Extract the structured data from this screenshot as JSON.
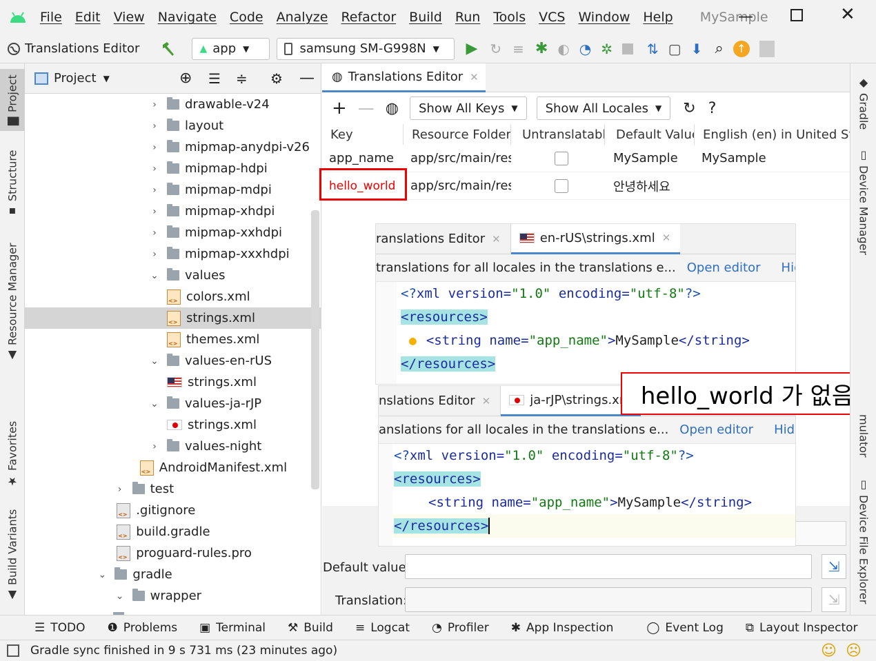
{
  "menubar": {
    "items": [
      "File",
      "Edit",
      "View",
      "Navigate",
      "Code",
      "Analyze",
      "Refactor",
      "Build",
      "Run",
      "Tools",
      "VCS",
      "Window",
      "Help"
    ],
    "project_name": "MySample",
    "window_controls": [
      "minimize-icon",
      "maximize-icon",
      "close-icon"
    ]
  },
  "toolbar": {
    "breadcrumb": "Translations Editor",
    "module": "app",
    "device": "samsung SM-G998N"
  },
  "left_tool_tabs": [
    "Project",
    "Structure",
    "Resource Manager",
    "Favorites",
    "Build Variants"
  ],
  "right_tool_tabs": [
    "Gradle",
    "Device Manager",
    "mulator",
    "Device File Explorer"
  ],
  "project_panel": {
    "title": "Project",
    "tree": [
      {
        "label": "drawable-v24",
        "type": "folder",
        "arrow": "›",
        "indent": 1
      },
      {
        "label": "layout",
        "type": "folder",
        "arrow": "›",
        "indent": 1
      },
      {
        "label": "mipmap-anydpi-v26",
        "type": "folder",
        "arrow": "›",
        "indent": 1
      },
      {
        "label": "mipmap-hdpi",
        "type": "folder",
        "arrow": "›",
        "indent": 1
      },
      {
        "label": "mipmap-mdpi",
        "type": "folder",
        "arrow": "›",
        "indent": 1
      },
      {
        "label": "mipmap-xhdpi",
        "type": "folder",
        "arrow": "›",
        "indent": 1
      },
      {
        "label": "mipmap-xxhdpi",
        "type": "folder",
        "arrow": "›",
        "indent": 1
      },
      {
        "label": "mipmap-xxxhdpi",
        "type": "folder",
        "arrow": "›",
        "indent": 1
      },
      {
        "label": "values",
        "type": "folder",
        "arrow": "⌄",
        "indent": 1
      },
      {
        "label": "colors.xml",
        "type": "xml",
        "arrow": "",
        "indent": 2
      },
      {
        "label": "strings.xml",
        "type": "xml",
        "arrow": "",
        "indent": 2,
        "selected": true
      },
      {
        "label": "themes.xml",
        "type": "xml",
        "arrow": "",
        "indent": 2
      },
      {
        "label": "values-en-rUS",
        "type": "folder",
        "arrow": "⌄",
        "indent": 1
      },
      {
        "label": "strings.xml",
        "type": "flag-us",
        "arrow": "",
        "indent": 2
      },
      {
        "label": "values-ja-rJP",
        "type": "folder",
        "arrow": "⌄",
        "indent": 1
      },
      {
        "label": "strings.xml",
        "type": "flag-jp",
        "arrow": "",
        "indent": 2
      },
      {
        "label": "values-night",
        "type": "folder",
        "arrow": "›",
        "indent": 1
      },
      {
        "label": "AndroidManifest.xml",
        "type": "manifest",
        "arrow": "",
        "indent": 0.6
      },
      {
        "label": "test",
        "type": "folder",
        "arrow": "›",
        "indent": -0.8
      },
      {
        "label": ".gitignore",
        "type": "file",
        "arrow": "",
        "indent": -0.6
      },
      {
        "label": "build.gradle",
        "type": "gradle",
        "arrow": "",
        "indent": -0.6
      },
      {
        "label": "proguard-rules.pro",
        "type": "file",
        "arrow": "",
        "indent": -0.6
      },
      {
        "label": "gradle",
        "type": "folder",
        "arrow": "⌄",
        "indent": -1.7
      },
      {
        "label": "wrapper",
        "type": "folder",
        "arrow": "⌄",
        "indent": -0.8
      }
    ]
  },
  "editor": {
    "tab_label": "Translations Editor",
    "show_keys": "Show All Keys",
    "show_locales": "Show All Locales",
    "help": "?",
    "columns": [
      "Key",
      "Resource Folder",
      "Untranslatable",
      "Default Value",
      "English (en) in United Sta"
    ],
    "rows": [
      {
        "key": "app_name",
        "folder": "app/src/main/res",
        "default": "MySample",
        "english": "MySample"
      },
      {
        "key": "hello_world",
        "folder": "app/src/main/res",
        "default": "안녕하세요",
        "english": ""
      }
    ],
    "default_value_label": "Default value:",
    "translation_label": "Translation:"
  },
  "overlay_us": {
    "tab_prev": "ranslations Editor",
    "tab_active": "en-rUS\\strings.xml",
    "notice": "translations for all locales in the translations e...",
    "open_editor": "Open editor",
    "hide": "Hide nc",
    "code": [
      "<?xml version=\"1.0\" encoding=\"utf-8\"?>",
      "<resources>",
      "    <string name=\"app_name\">MySample</string>",
      "</resources>"
    ]
  },
  "overlay_jp": {
    "tab_prev": "nslations Editor",
    "tab_active": "ja-rJP\\strings.xm",
    "notice": "anslations for all locales in the translations e...",
    "open_editor": "Open editor",
    "hide": "Hide not",
    "code": [
      "<?xml version=\"1.0\" encoding=\"utf-8\"?>",
      "<resources>",
      "    <string name=\"app_name\">MySample</string>",
      "</resources>"
    ]
  },
  "callout": "hello_world 가 없음",
  "bottom_tabs": [
    "TODO",
    "Problems",
    "Terminal",
    "Build",
    "Logcat",
    "Profiler",
    "App Inspection",
    "Event Log",
    "Layout Inspector"
  ],
  "status": "Gradle sync finished in 9 s 731 ms (23 minutes ago)",
  "colors": {
    "highlight_red": "#e00000",
    "link": "#2f6fc0",
    "tag_bg": "#a6e4e4"
  }
}
